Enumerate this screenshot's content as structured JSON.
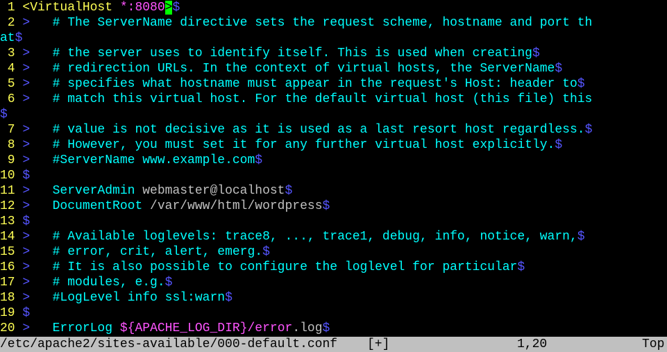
{
  "editor": {
    "line1": {
      "num": " 1 ",
      "tag": "<VirtualHost",
      "addr": "*:8080",
      "cursor": ">",
      "eol": "$"
    },
    "line2": {
      "num": " 2 ",
      "tab": ">",
      "pad": "   ",
      "text": "# The ServerName directive sets the request scheme, hostname and port th"
    },
    "line2wrap": {
      "text": "at",
      "eol": "$"
    },
    "line3": {
      "num": " 3 ",
      "tab": ">",
      "pad": "   ",
      "text": "# the server uses to identify itself. This is used when creating",
      "eol": "$"
    },
    "line4": {
      "num": " 4 ",
      "tab": ">",
      "pad": "   ",
      "text": "# redirection URLs. In the context of virtual hosts, the ServerName",
      "eol": "$"
    },
    "line5": {
      "num": " 5 ",
      "tab": ">",
      "pad": "   ",
      "text": "# specifies what hostname must appear in the request's Host: header to",
      "eol": "$"
    },
    "line6": {
      "num": " 6 ",
      "tab": ">",
      "pad": "   ",
      "text": "# match this virtual host. For the default virtual host (this file) this"
    },
    "line6wrap": {
      "eol": "$"
    },
    "line7": {
      "num": " 7 ",
      "tab": ">",
      "pad": "   ",
      "text": "# value is not decisive as it is used as a last resort host regardless.",
      "eol": "$"
    },
    "line8": {
      "num": " 8 ",
      "tab": ">",
      "pad": "   ",
      "text": "# However, you must set it for any further virtual host explicitly.",
      "eol": "$"
    },
    "line9": {
      "num": " 9 ",
      "tab": ">",
      "pad": "   ",
      "text": "#ServerName www.example.com",
      "eol": "$"
    },
    "line10": {
      "num": "10 ",
      "eol": "$"
    },
    "line11": {
      "num": "11 ",
      "tab": ">",
      "pad": "   ",
      "key": "ServerAdmin",
      "val": " webmaster@localhost",
      "eol": "$"
    },
    "line12": {
      "num": "12 ",
      "tab": ">",
      "pad": "   ",
      "key": "DocumentRoot",
      "val": " /var/www/html/wordpress",
      "eol": "$"
    },
    "line13": {
      "num": "13 ",
      "eol": "$"
    },
    "line14": {
      "num": "14 ",
      "tab": ">",
      "pad": "   ",
      "text": "# Available loglevels: trace8, ..., trace1, debug, info, notice, warn,",
      "eol": "$"
    },
    "line15": {
      "num": "15 ",
      "tab": ">",
      "pad": "   ",
      "text": "# error, crit, alert, emerg.",
      "eol": "$"
    },
    "line16": {
      "num": "16 ",
      "tab": ">",
      "pad": "   ",
      "text": "# It is also possible to configure the loglevel for particular",
      "eol": "$"
    },
    "line17": {
      "num": "17 ",
      "tab": ">",
      "pad": "   ",
      "text": "# modules, e.g.",
      "eol": "$"
    },
    "line18": {
      "num": "18 ",
      "tab": ">",
      "pad": "   ",
      "text": "#LogLevel info ssl:warn",
      "eol": "$"
    },
    "line19": {
      "num": "19 ",
      "eol": "$"
    },
    "line20": {
      "num": "20 ",
      "tab": ">",
      "pad": "   ",
      "key": "ErrorLog",
      "sp": " ",
      "var": "${APACHE_LOG_DIR}",
      "path": "/error",
      "ext": ".log",
      "eol": "$"
    }
  },
  "status": {
    "filename": "/etc/apache2/sites-available/000-default.conf",
    "modified": "[+]",
    "position": "1,20",
    "scroll": "Top"
  },
  "colors": {
    "background": "#000000",
    "line_number": "#ffff55",
    "comment": "#00ffff",
    "special_chars": "#5555ff",
    "cursor": "#00ff00",
    "statusbar": "#c0c0c0"
  }
}
